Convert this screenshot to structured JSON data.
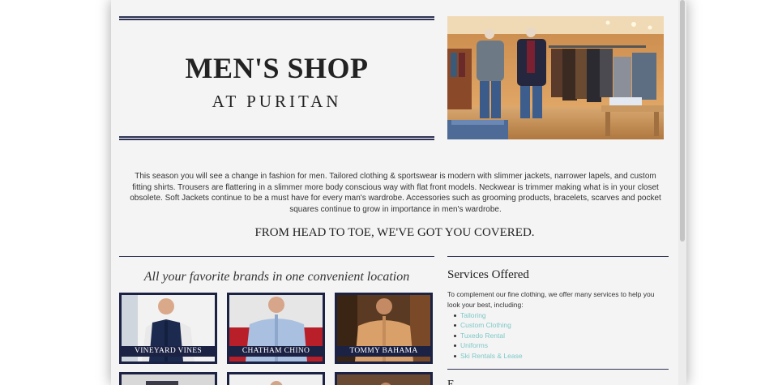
{
  "hero": {
    "title": "MEN'S SHOP",
    "subtitle": "AT PURITAN"
  },
  "intro": {
    "text": "This season you will see a change in fashion for men. Tailored clothing & sportswear is modern with slimmer jackets, narrower lapels, and custom fitting shirts. Trousers are flattering in a slimmer more body conscious way with flat front models. Neckwear is trimmer making what is in your closet obsolete. Soft Jackets continue to be a must have for every man's wardrobe. Accessories such as grooming products, bracelets, scarves and pocket squares continue to grow in importance in men's wardrobe.",
    "tagline": "FROM HEAD TO TOE, WE'VE GOT YOU COVERED."
  },
  "brands": {
    "heading": "All your favorite brands in one convenient location",
    "tiles": [
      {
        "label": "VINEYARD VINES"
      },
      {
        "label": "CHATHAM CHINO"
      },
      {
        "label": "TOMMY BAHAMA"
      }
    ]
  },
  "services": {
    "title": "Services Offered",
    "intro": "To complement our fine clothing, we offer many services to help you look your best, including:",
    "items": [
      "Tailoring",
      "Custom Clothing",
      "Tuxedo Rental",
      "Uniforms",
      "Ski Rentals & Lease"
    ]
  },
  "next_section": {
    "heading": "E"
  },
  "colors": {
    "navy": "#1c2244",
    "link": "#7fc8c8",
    "page_bg": "#f4f4f4"
  }
}
